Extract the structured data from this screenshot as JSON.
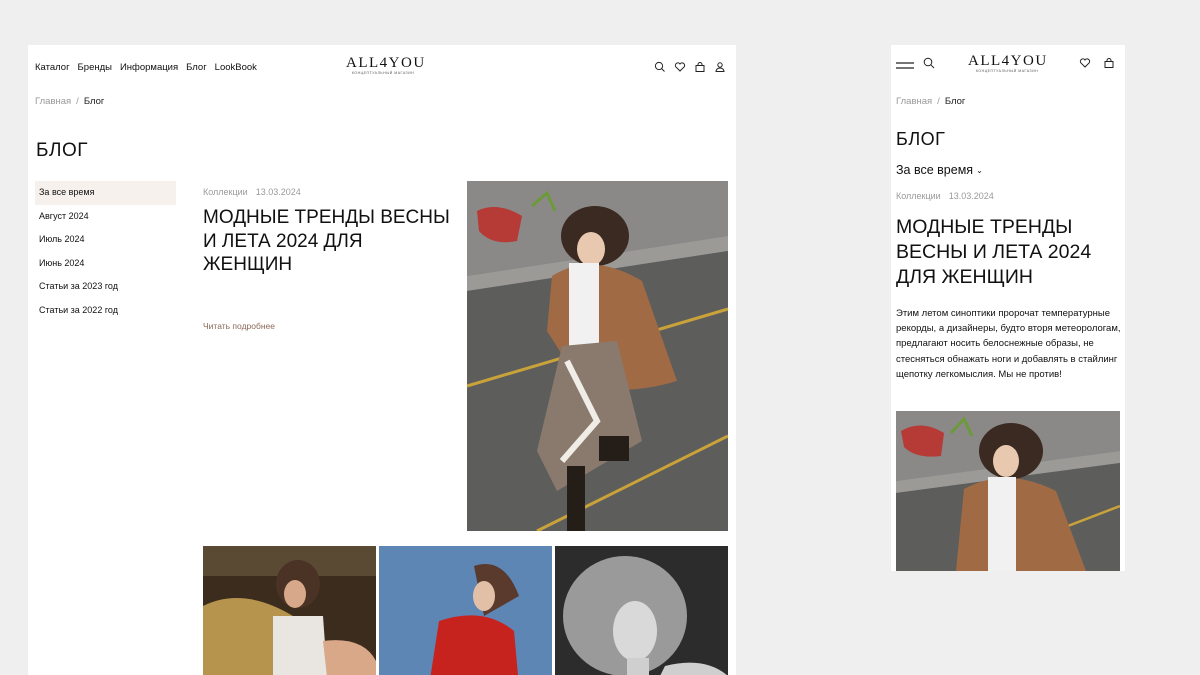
{
  "desktop": {
    "nav": [
      "Каталог",
      "Бренды",
      "Информация",
      "Блог",
      "LookBook"
    ],
    "logo": {
      "mark": "ALL4YOU",
      "tagline": "КОНЦЕПТУАЛЬНЫЙ МАГАЗИН"
    },
    "header_icons": [
      "search-icon",
      "heart-icon",
      "bag-icon",
      "user-icon"
    ],
    "breadcrumb": {
      "home": "Главная",
      "separator": "/",
      "current": "Блог"
    },
    "page_title": "БЛОГ",
    "filters": [
      {
        "label": "За все время",
        "active": true
      },
      {
        "label": "Август 2024",
        "active": false
      },
      {
        "label": "Июль 2024",
        "active": false
      },
      {
        "label": "Июнь 2024",
        "active": false
      },
      {
        "label": "Статьи за 2023 год",
        "active": false
      },
      {
        "label": "Статьи за 2022 год",
        "active": false
      }
    ],
    "article": {
      "category": "Коллекции",
      "date": "13.03.2024",
      "title": "МОДНЫЕ ТРЕНДЫ ВЕСНЫ И ЛЕТА 2024 ДЛЯ ЖЕНЩИН",
      "read_more": "Читать подробнее"
    }
  },
  "mobile": {
    "logo": {
      "mark": "ALL4YOU",
      "tagline": "КОНЦЕПТУАЛЬНЫЙ МАГАЗИН"
    },
    "breadcrumb": {
      "home": "Главная",
      "separator": "/",
      "current": "Блог"
    },
    "page_title": "БЛОГ",
    "period_select": "За все время",
    "article": {
      "category": "Коллекции",
      "date": "13.03.2024",
      "title": "МОДНЫЕ ТРЕНДЫ ВЕСНЫ И ЛЕТА 2024 ДЛЯ ЖЕНЩИН",
      "excerpt": "Этим летом синоптики пророчат температурные рекорды, а дизайнеры, будто вторя метеорологам, предлагают носить белоснежные образы, не стесняться обнажать ноги и добавлять в стайлинг щепотку легкомыслия. Мы не против!"
    }
  },
  "colors": {
    "page_bg": "#efefef",
    "panel_bg": "#ffffff",
    "active_filter_bg": "#f7f1ee",
    "read_more": "#8a6a58",
    "muted_text": "#9a9a9a"
  }
}
